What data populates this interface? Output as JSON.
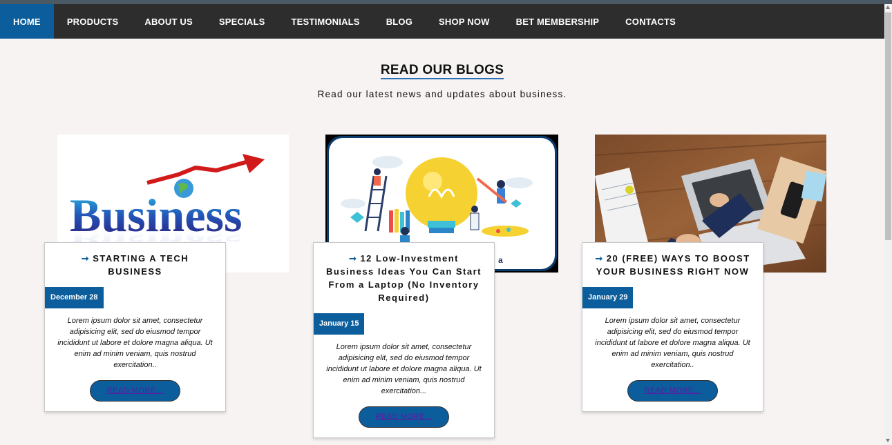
{
  "nav": {
    "items": [
      {
        "label": "HOME",
        "active": true
      },
      {
        "label": "PRODUCTS"
      },
      {
        "label": "ABOUT US"
      },
      {
        "label": "SPECIALS"
      },
      {
        "label": "TESTIMONIALS"
      },
      {
        "label": "BLOG"
      },
      {
        "label": "SHOP NOW"
      },
      {
        "label": "BET MEMBERSHIP"
      },
      {
        "label": "CONTACTS"
      }
    ]
  },
  "section": {
    "title": "READ OUR BLOGS",
    "subtitle": "Read our latest news and updates about business."
  },
  "posts": [
    {
      "image": "business-word-art-image",
      "arrow": "➞",
      "title": "STARTING A TECH BUSINESS",
      "date": "December 28",
      "excerpt": "Lorem ipsum dolor sit amet, consectetur adipisicing elit, sed do eiusmod tempor incididunt ut labore et dolore magna aliqua. Ut enim ad minim veniam, quis nostrud exercitation..",
      "button": "READ MORE..."
    },
    {
      "image": "lightbulb-ideas-illustration",
      "arrow": "➞",
      "title": "12 Low-Investment Business Ideas You Can Start From a Laptop (No Inventory Required)",
      "date": "January 15",
      "excerpt": "Lorem ipsum dolor sit amet, consectetur adipisicing elit, sed do eiusmod tempor incididunt ut labore et dolore magna aliqua. Ut enim ad minim veniam, quis nostrud exercitation...",
      "button": "READ MORE..."
    },
    {
      "image": "laptop-desk-photo",
      "arrow": "➞",
      "title": "20 (FREE) WAYS TO BOOST YOUR BUSINESS RIGHT NOW",
      "date": "January 29",
      "excerpt": "Lorem ipsum dolor sit amet, consectetur adipisicing elit, sed do eiusmod tempor incididunt ut labore et dolore magna aliqua. Ut enim ad minim veniam, quis nostrud exercitation..",
      "button": "READ MORE..."
    }
  ],
  "colors": {
    "nav_bg": "#2d2d2d",
    "accent": "#0b5d9c",
    "page_bg": "#f7f3f3"
  }
}
